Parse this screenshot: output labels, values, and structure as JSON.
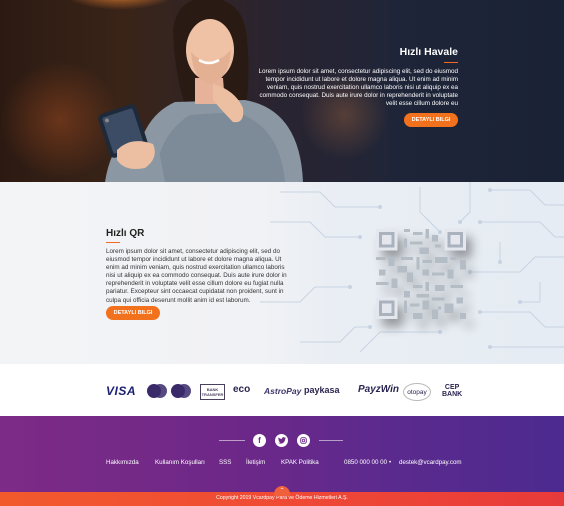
{
  "hero": {
    "title": "Hızlı Havale",
    "body": "Lorem ipsum dolor sit amet, consectetur adipiscing elit, sed do eiusmod tempor incididunt ut labore et dolore magna aliqua. Ut enim ad minim veniam, quis nostrud exercitation ullamco laboris nisi ut aliquip ex ea commodo consequat. Duis aute irure dolor in reprehenderit in voluptate velit esse cillum dolore eu",
    "button": "DETAYLI BILGI"
  },
  "qr": {
    "title": "Hızlı QR",
    "body": "Lorem ipsum dolor sit amet, consectetur adipiscing elit, sed do eiusmod tempor incididunt ut labore et dolore magna aliqua. Ut enim ad minim veniam, quis nostrud exercitation ullamco laboris nisi ut aliquip ex ea commodo consequat. Duis aute irure dolor in reprehenderit in voluptate velit esse cillum dolore eu fugiat nulla pariatur. Excepteur sint occaecat cupidatat non proident, sunt in culpa qui officia deserunt mollit anim id est laborum.",
    "button": "DETAYLI BILGI"
  },
  "payments": {
    "visa": "VISA",
    "bank_line1": "BANK",
    "bank_line2": "TRANSFER",
    "eco": "eco",
    "astropay": "AstroPay",
    "paykasa": "paykasa",
    "payzwin": "PayzWin",
    "otopay": "otopay",
    "cep_line1": "CEP",
    "cep_line2": "BANK"
  },
  "footer": {
    "social": [
      "facebook-icon",
      "twitter-icon",
      "instagram-icon"
    ],
    "nav": [
      "Hakkımızda",
      "Kullanım Koşulları",
      "SSS",
      "İletişim",
      "KPAK Politika"
    ],
    "phone": "0850 000 00 00",
    "separator": "•",
    "email": "destek@vcardpay.com",
    "copyright": "Copyright 2019 Vcardpay Para ve Ödeme Hizmetleri A.Ş.",
    "accent": "#f2711c"
  }
}
